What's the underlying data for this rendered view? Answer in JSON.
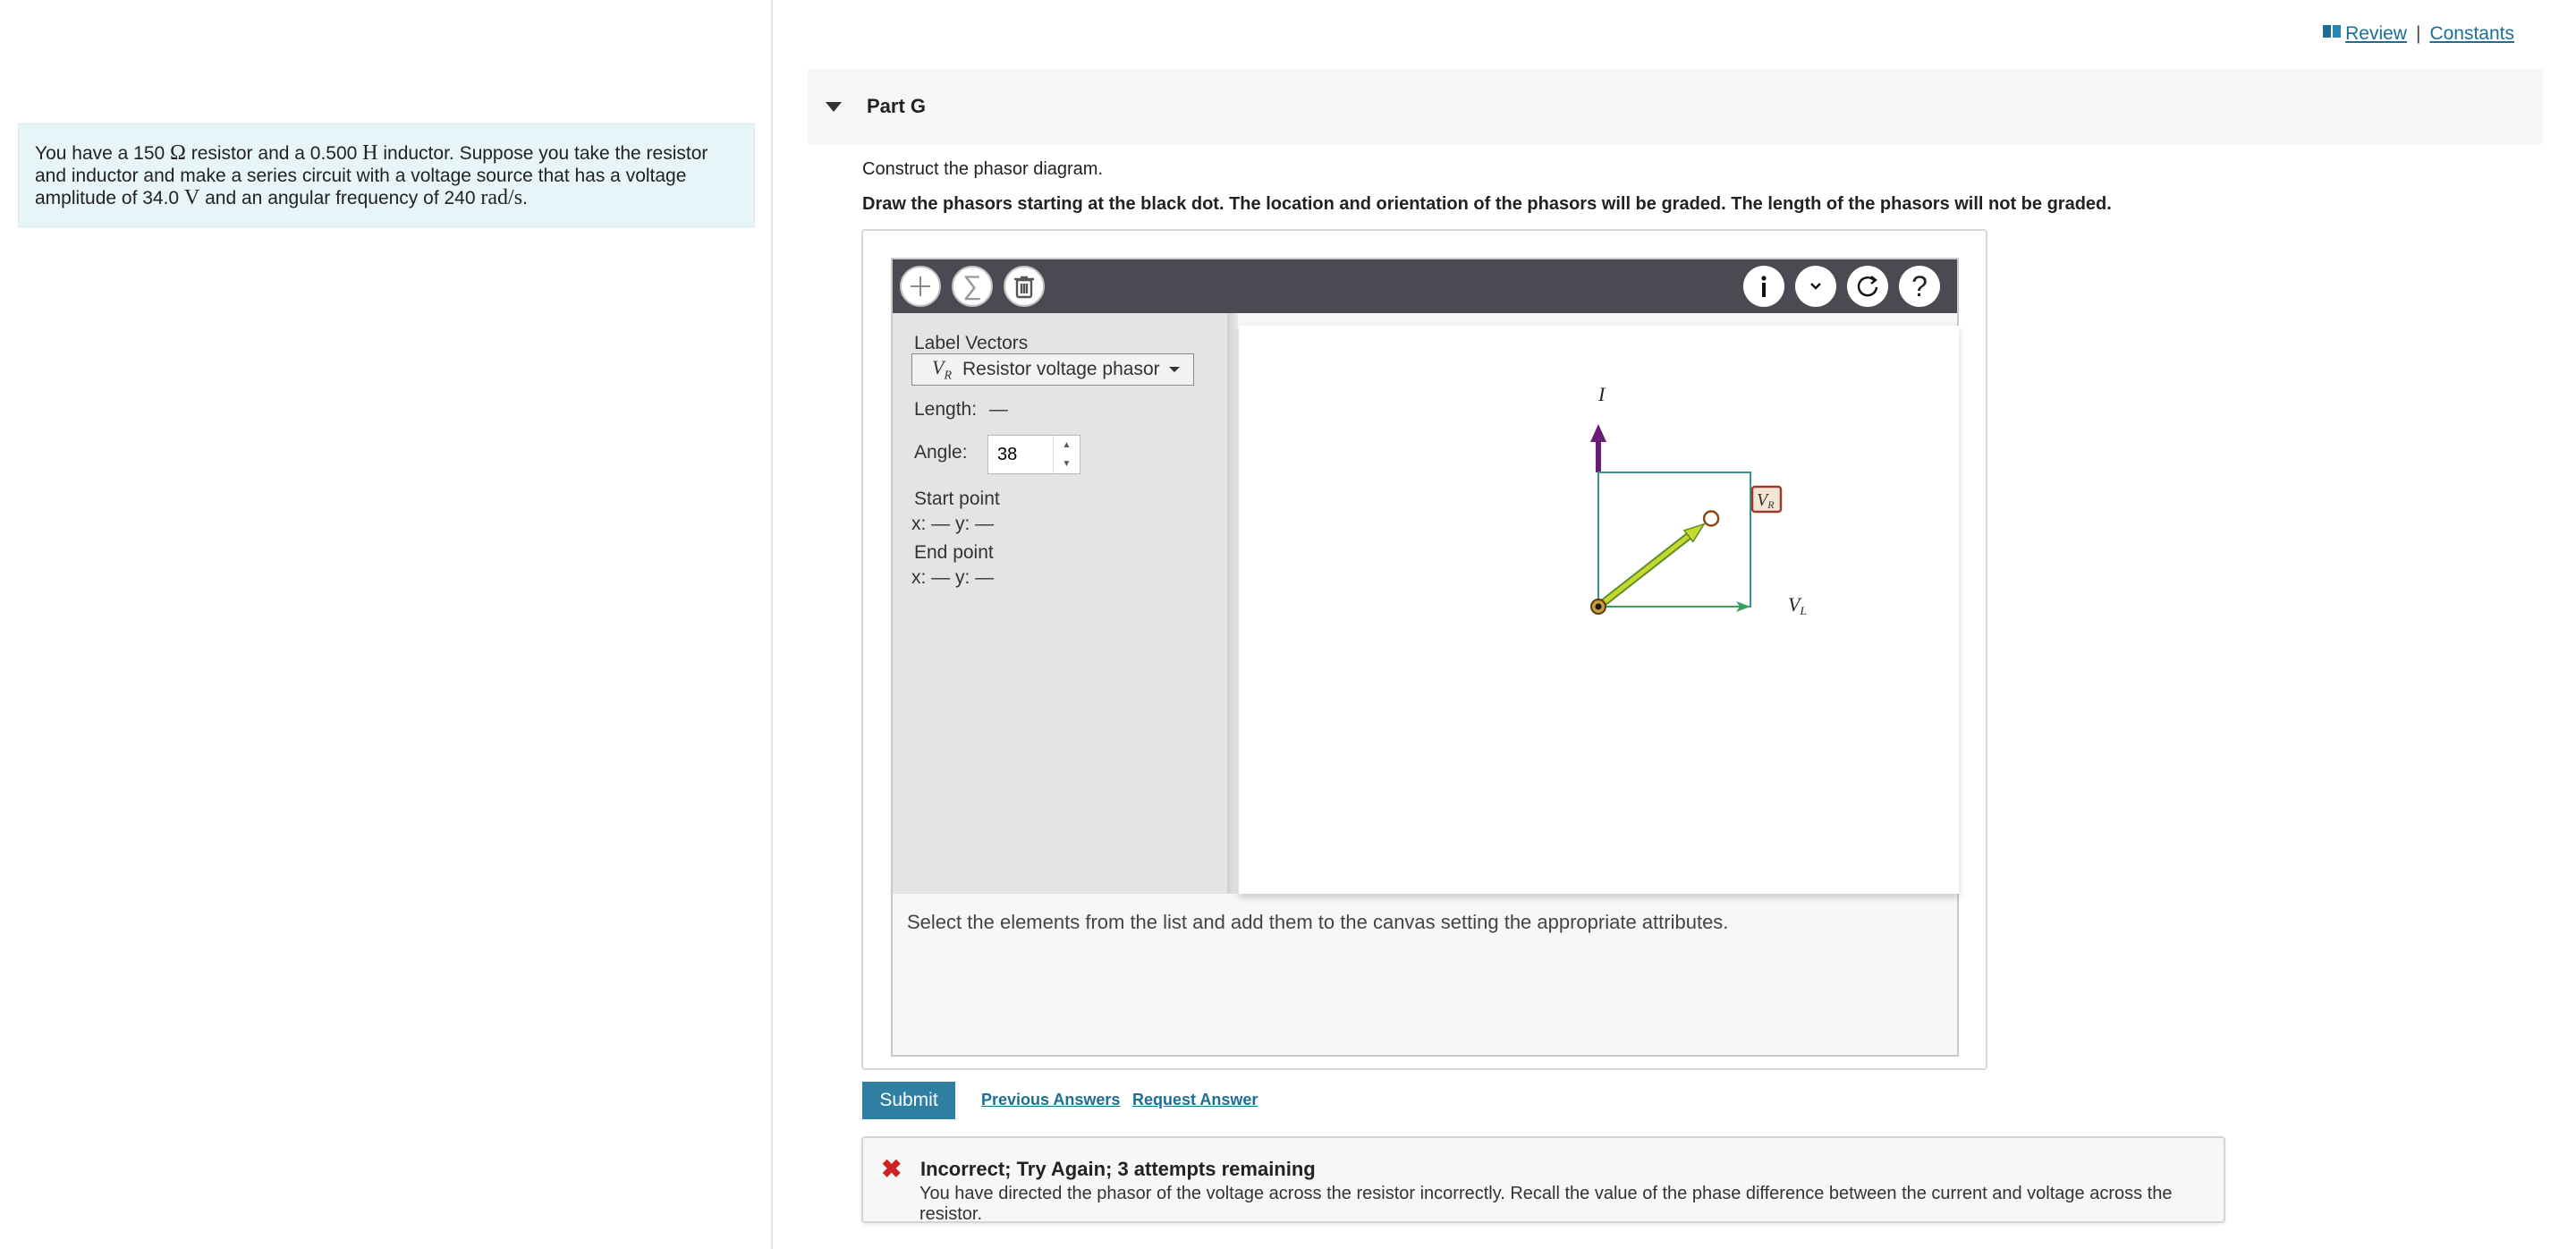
{
  "header": {
    "review_label": "Review",
    "separator": "|",
    "constants_label": "Constants"
  },
  "problem": {
    "text_1": "You have a 150 ",
    "unit_ohm": "Ω",
    "text_2": " resistor and a 0.500 ",
    "unit_henry": "H",
    "text_3": " inductor. Suppose you take the resistor and inductor and make a series circuit with a voltage source that has a voltage amplitude of 34.0 ",
    "unit_volt": "V",
    "text_4": " and an angular frequency of 240 ",
    "unit_rads": "rad/s",
    "text_5": "."
  },
  "part": {
    "title": "Part G",
    "instruction": "Construct the phasor diagram.",
    "instruction_bold": "Draw the phasors starting at the black dot. The location and orientation of the phasors will be graded. The length of the phasors will not be graded."
  },
  "toolbar": {
    "icons": [
      "plus-icon",
      "sigma-icon",
      "trash-icon",
      "info-icon",
      "chevron-down-icon",
      "reset-icon",
      "help-icon"
    ],
    "help_glyph": "?",
    "sigma_glyph": "∑"
  },
  "side_panel": {
    "label_vectors_title": "Label Vectors",
    "selected_vector_symbol": "V",
    "selected_vector_subscript": "R",
    "selected_vector_label": "Resistor voltage phasor",
    "length_label": "Length:",
    "length_value": "—",
    "angle_label": "Angle:",
    "angle_value": "38",
    "start_point_title": "Start point",
    "start_point_coords": "x: — y: —",
    "end_point_title": "End point",
    "end_point_coords": "x: — y: —"
  },
  "canvas": {
    "label_current": "I",
    "label_vr_symbol": "V",
    "label_vr_subscript": "R",
    "label_vl_symbol": "V",
    "label_vl_subscript": "L",
    "vr_angle_deg": 38,
    "colors": {
      "current_arrow": "#6a1b7a",
      "vr_arrow_fill": "#c7d82c",
      "vr_arrow_outline": "#5b8f2a",
      "vl_arrow": "#3aa05a",
      "box": "#3a8f9a",
      "origin_dot": "#1a1a1a"
    }
  },
  "status": {
    "message": "Select the elements from the list and add them to the canvas setting the appropriate attributes."
  },
  "actions": {
    "submit_label": "Submit",
    "previous_answers_label": "Previous Answers",
    "request_answer_label": "Request Answer"
  },
  "feedback": {
    "icon": "close-icon",
    "title": "Incorrect; Try Again; 3 attempts remaining",
    "message": "You have directed the phasor of the voltage across the resistor incorrectly. Recall the value of the phase difference between the current and voltage across the resistor.",
    "color": "#cc2222"
  }
}
